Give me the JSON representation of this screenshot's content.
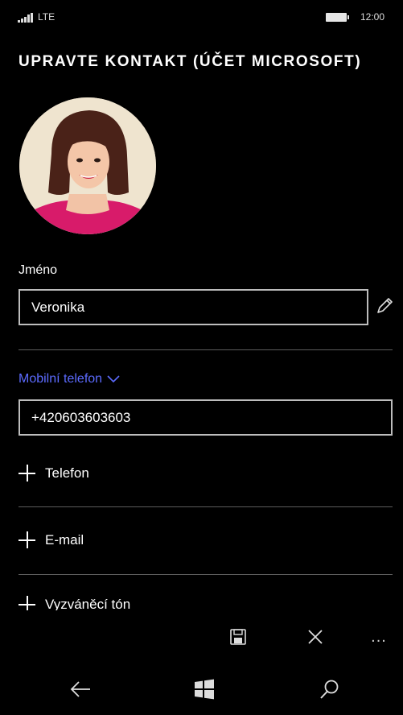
{
  "status_bar": {
    "network": "LTE",
    "time": "12:00"
  },
  "page": {
    "title": "UPRAVTE KONTAKT (ÚČET MICROSOFT)"
  },
  "name_field": {
    "label": "Jméno",
    "value": "Veronika"
  },
  "phone_field": {
    "type_label": "Mobilní telefon",
    "value": "+420603603603"
  },
  "add_items": [
    {
      "label": "Telefon"
    },
    {
      "label": "E-mail"
    },
    {
      "label": "Vyzváněcí tón"
    }
  ],
  "app_bar": {
    "more_label": "..."
  },
  "colors": {
    "accent": "#5c6bff",
    "background": "#000000",
    "border": "#bdbdbd"
  },
  "icons": {
    "save": "save-icon",
    "cancel": "close-icon",
    "edit": "pencil-icon",
    "back": "back-arrow-icon",
    "start": "windows-logo-icon",
    "search": "search-icon"
  }
}
